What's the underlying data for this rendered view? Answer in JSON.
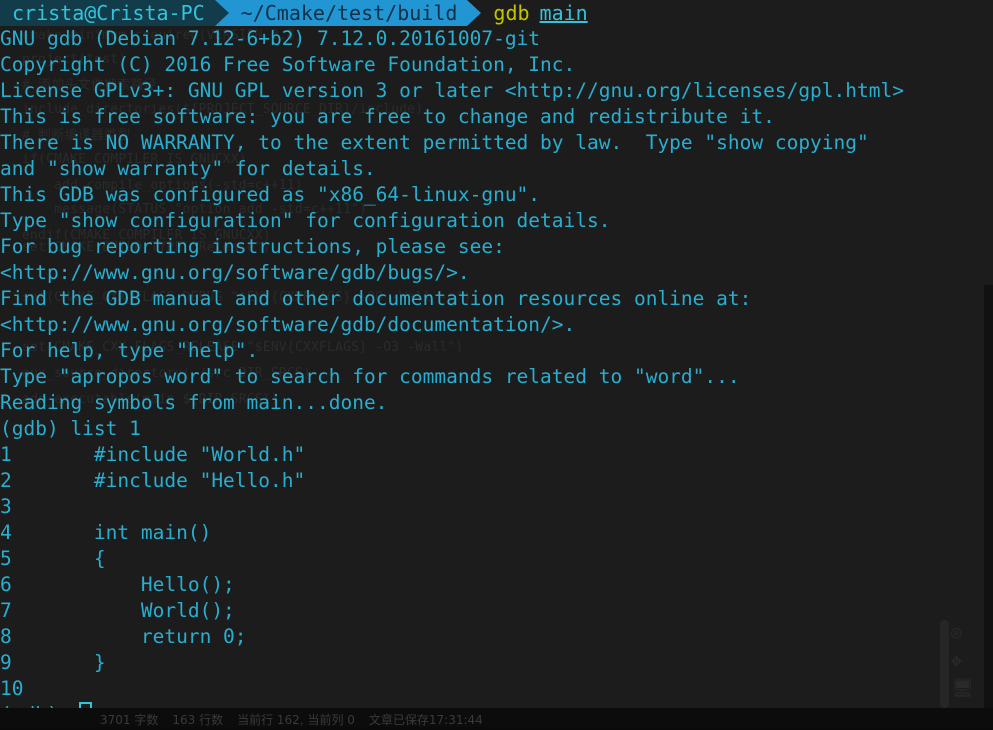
{
  "window": {
    "title": "gdb main",
    "background": "#1c1c1c",
    "foreground": "#29aed0"
  },
  "prompt": {
    "host": "crista@Crista-PC",
    "path": "~/Cmake/test/build",
    "command": "gdb",
    "argument": "main",
    "host_bg": "#123c49",
    "host_fg": "#33c3dd",
    "path_bg": "#2196d3",
    "path_fg": "#123047",
    "command_fg": "#c3c300",
    "argument_fg": "#33c3dd"
  },
  "output": {
    "lines": [
      "GNU gdb (Debian 7.12-6+b2) 7.12.0.20161007-git",
      "Copyright (C) 2016 Free Software Foundation, Inc.",
      "License GPLv3+: GNU GPL version 3 or later <http://gnu.org/licenses/gpl.html>",
      "This is free software: you are free to change and redistribute it.",
      "There is NO WARRANTY, to the extent permitted by law.  Type \"show copying\"",
      "and \"show warranty\" for details.",
      "This GDB was configured as \"x86_64-linux-gnu\".",
      "Type \"show configuration\" for configuration details.",
      "For bug reporting instructions, please see:",
      "<http://www.gnu.org/software/gdb/bugs/>.",
      "Find the GDB manual and other documentation resources online at:",
      "<http://www.gnu.org/software/gdb/documentation/>.",
      "For help, type \"help\".",
      "Type \"apropos word\" to search for commands related to \"word\"...",
      "Reading symbols from main...done.",
      "(gdb) list 1",
      "1       #include \"World.h\"",
      "2       #include \"Hello.h\"",
      "3",
      "4       int main()",
      "5       {",
      "6           Hello();",
      "7           World();",
      "8           return 0;",
      "9       }",
      "10"
    ]
  },
  "command_prompt": {
    "text": "(gdb) ",
    "cursor": "block-outline-cursor"
  },
  "ghost": {
    "note": "faint remnants of a previous editor screen bleeding through",
    "lines": [
      "cmake_minimum_required(VERSION 2.8)",
      "project(test)",
      "# 添加头文件搜索路径",
      "include_directories(${PROJECT_SOURCE_DIR}/include)",
      "# 判断编译器类型",
      "if(CMAKE_COMPILER_IS_GNUCXX)",
      "    add_compile_options(-std=c++11)",
      "    message(STATUS \"option add -std=c++11\")",
      "endif(CMAKE_COMPILER_IS_GNUCXX)",
      "set(CMAKE_BUILD_TYPE \"Release\")",
      "set(CMAKE_CXX_FLAGS_DEBUG \"$ENV{CXXFLAGS} -O0 -Wall -g\")",
      "set(CMAKE_CXX_FLAGS_RELEASE \"$ENV{CXXFLAGS} -O3 -Wall\")",
      "aux_source_directory(./src DIR_SRCS)",
      "add_executable(main ${DIR_SRCS})"
    ],
    "icons": [
      "crosshair-icon",
      "move-arrows-icon",
      "monitor-icon"
    ]
  },
  "status_bar": {
    "app": "MarkdownPad",
    "word_count": "3701 字数",
    "line_count": "163 行数",
    "current_line": "当前行 162, 当前列 0",
    "saved": "文章已保存17:31:44"
  }
}
